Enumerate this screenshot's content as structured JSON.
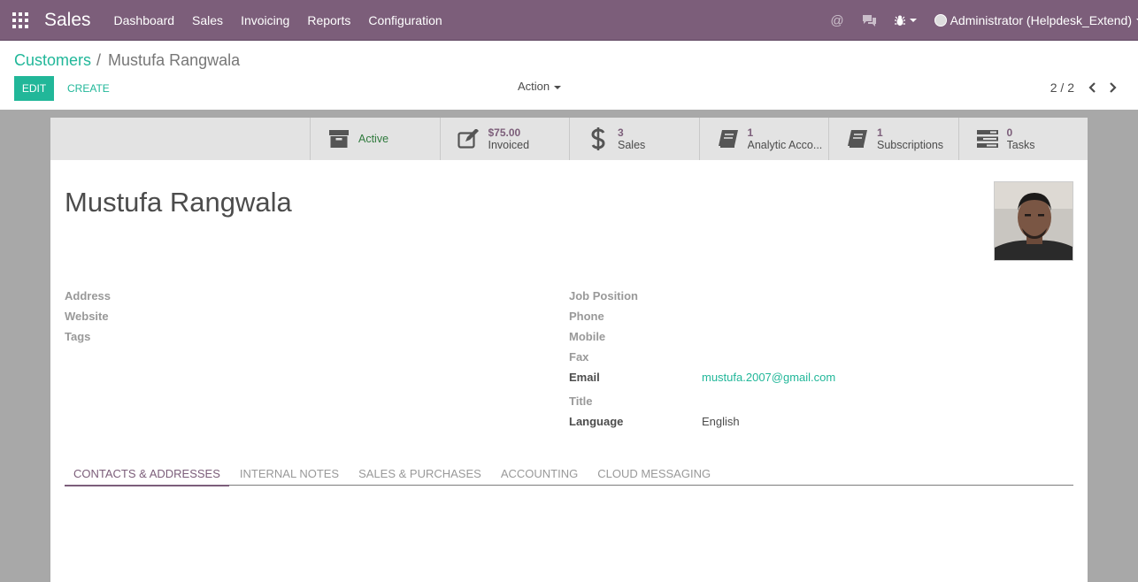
{
  "navbar": {
    "brand": "Sales",
    "menu": [
      "Dashboard",
      "Sales",
      "Invoicing",
      "Reports",
      "Configuration"
    ],
    "user": "Administrator (Helpdesk_Extend)",
    "icons": [
      "apps-grid-icon",
      "at-icon",
      "chat-icon",
      "bug-icon"
    ]
  },
  "breadcrumb": {
    "parent": "Customers",
    "separator": "/",
    "current": "Mustufa Rangwala"
  },
  "controls": {
    "edit": "EDIT",
    "create": "CREATE",
    "action": "Action",
    "pager": "2 / 2"
  },
  "stat_buttons": [
    {
      "icon": "archive-icon",
      "value": "",
      "label": "Active"
    },
    {
      "icon": "pencil-square-icon",
      "value": "$75.00",
      "label": "Invoiced"
    },
    {
      "icon": "dollar-icon",
      "value": "3",
      "label": "Sales"
    },
    {
      "icon": "book-icon",
      "value": "1",
      "label": "Analytic Acco..."
    },
    {
      "icon": "book-icon",
      "value": "1",
      "label": "Subscriptions"
    },
    {
      "icon": "tasks-icon",
      "value": "0",
      "label": "Tasks"
    }
  ],
  "partner": {
    "name": "Mustufa Rangwala",
    "photo_alt": "Profile photo"
  },
  "fields_left": {
    "address": "Address",
    "website": "Website",
    "tags": "Tags"
  },
  "fields_right": {
    "job_position": "Job Position",
    "phone": "Phone",
    "mobile": "Mobile",
    "fax": "Fax",
    "email_label": "Email",
    "email_value": "mustufa.2007@gmail.com",
    "title": "Title",
    "language_label": "Language",
    "language_value": "English"
  },
  "tabs": [
    "CONTACTS & ADDRESSES",
    "INTERNAL NOTES",
    "SALES & PURCHASES",
    "ACCOUNTING",
    "CLOUD MESSAGING"
  ],
  "colors": {
    "brand": "#7c5e7a",
    "accent": "#21b799",
    "active_green": "#2f7a3d"
  }
}
